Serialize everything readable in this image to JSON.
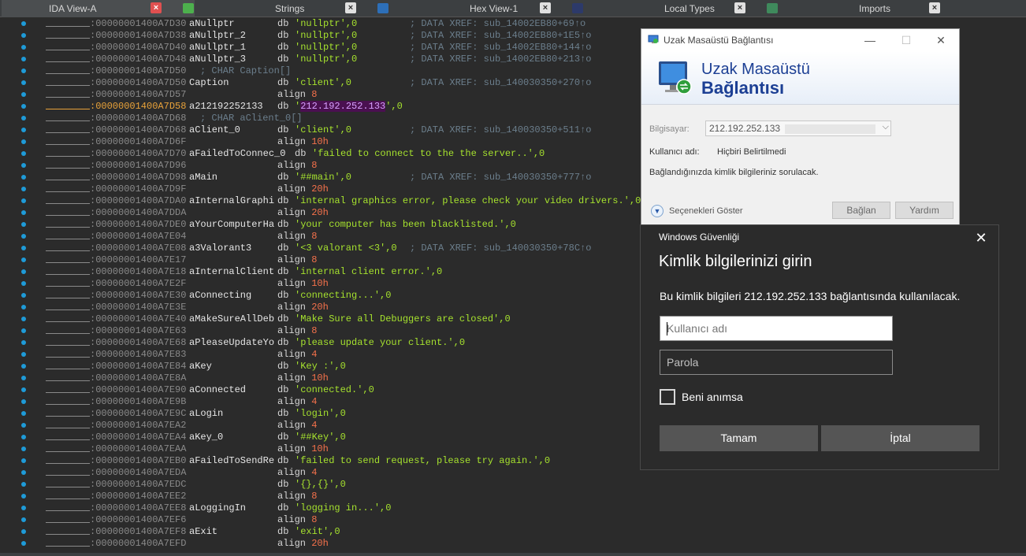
{
  "tabs": [
    {
      "label": "IDA View-A",
      "icon": "ida-view-icon",
      "active": true
    },
    {
      "label": "Strings",
      "icon": "strings-icon",
      "active": false
    },
    {
      "label": "Hex View-1",
      "icon": "hex-view-icon",
      "active": false
    },
    {
      "label": "Local Types",
      "icon": "local-types-icon",
      "active": false
    },
    {
      "label": "Imports",
      "icon": "imports-icon",
      "active": false
    }
  ],
  "listing": [
    {
      "addr": ":00000001400A7D30",
      "label": "aNullptr",
      "kw": "db",
      "op": "'nullptr',0",
      "cmt": "; DATA XREF: sub_14002EB80+69↑o"
    },
    {
      "addr": ":00000001400A7D38",
      "label": "aNullptr_2",
      "kw": "db",
      "op": "'nullptr',0",
      "cmt": "; DATA XREF: sub_14002EB80+1E5↑o"
    },
    {
      "addr": ":00000001400A7D40",
      "label": "aNullptr_1",
      "kw": "db",
      "op": "'nullptr',0",
      "cmt": "; DATA XREF: sub_14002EB80+144↑o"
    },
    {
      "addr": ":00000001400A7D48",
      "label": "aNullptr_3",
      "kw": "db",
      "op": "'nullptr',0",
      "cmt": "; DATA XREF: sub_14002EB80+213↑o"
    },
    {
      "addr": ":00000001400A7D50",
      "fullcmt": "; CHAR Caption[]"
    },
    {
      "addr": ":00000001400A7D50",
      "label": "Caption",
      "kw": "db",
      "op": "'client',0",
      "cmt": "; DATA XREF: sub_140030350+270↑o"
    },
    {
      "addr": ":00000001400A7D57",
      "align": "align",
      "alignNum": "8"
    },
    {
      "addr": ":00000001400A7D58",
      "label": "a212192252133",
      "kw": "db",
      "op": "'212.192.252.133',0",
      "highlight": true
    },
    {
      "addr": ":00000001400A7D68",
      "fullcmt": "; CHAR aClient_0[]"
    },
    {
      "addr": ":00000001400A7D68",
      "label": "aClient_0",
      "kw": "db",
      "op": "'client',0",
      "cmt": "; DATA XREF: sub_140030350+511↑o"
    },
    {
      "addr": ":00000001400A7D6F",
      "align": "align",
      "alignNum": "10h"
    },
    {
      "addr": ":00000001400A7D70",
      "label": "aFailedToConnec_0",
      "kw": "db",
      "op": "'failed to connect to the the server..',0",
      "wide": true
    },
    {
      "addr": ":00000001400A7D96",
      "align": "align",
      "alignNum": "8"
    },
    {
      "addr": ":00000001400A7D98",
      "label": "aMain",
      "kw": "db",
      "op": "'##main',0",
      "cmt": "; DATA XREF: sub_140030350+777↑o"
    },
    {
      "addr": ":00000001400A7D9F",
      "align": "align",
      "alignNum": "20h"
    },
    {
      "addr": ":00000001400A7DA0",
      "label": "aInternalGraphi",
      "kw": "db",
      "op": "'internal graphics error, please check your video drivers.',0"
    },
    {
      "addr": ":00000001400A7DDA",
      "align": "align",
      "alignNum": "20h"
    },
    {
      "addr": ":00000001400A7DE0",
      "label": "aYourComputerHa",
      "kw": "db",
      "op": "'your computer has been blacklisted.',0"
    },
    {
      "addr": ":00000001400A7E04",
      "align": "align",
      "alignNum": "8"
    },
    {
      "addr": ":00000001400A7E08",
      "label": "a3Valorant3",
      "kw": "db",
      "op": "'<3 valorant <3',0",
      "cmt": "; DATA XREF: sub_140030350+78C↑o"
    },
    {
      "addr": ":00000001400A7E17",
      "align": "align",
      "alignNum": "8"
    },
    {
      "addr": ":00000001400A7E18",
      "label": "aInternalClient",
      "kw": "db",
      "op": "'internal client error.',0"
    },
    {
      "addr": ":00000001400A7E2F",
      "align": "align",
      "alignNum": "10h"
    },
    {
      "addr": ":00000001400A7E30",
      "label": "aConnecting",
      "kw": "db",
      "op": "'connecting...',0"
    },
    {
      "addr": ":00000001400A7E3E",
      "align": "align",
      "alignNum": "20h"
    },
    {
      "addr": ":00000001400A7E40",
      "label": "aMakeSureAllDeb",
      "kw": "db",
      "op": "'Make Sure all Debuggers are closed',0"
    },
    {
      "addr": ":00000001400A7E63",
      "align": "align",
      "alignNum": "8"
    },
    {
      "addr": ":00000001400A7E68",
      "label": "aPleaseUpdateYo",
      "kw": "db",
      "op": "'please update your client.',0"
    },
    {
      "addr": ":00000001400A7E83",
      "align": "align",
      "alignNum": "4"
    },
    {
      "addr": ":00000001400A7E84",
      "label": "aKey",
      "kw": "db",
      "op": "'Key :',0"
    },
    {
      "addr": ":00000001400A7E8A",
      "align": "align",
      "alignNum": "10h"
    },
    {
      "addr": ":00000001400A7E90",
      "label": "aConnected",
      "kw": "db",
      "op": "'connected.',0"
    },
    {
      "addr": ":00000001400A7E9B",
      "align": "align",
      "alignNum": "4"
    },
    {
      "addr": ":00000001400A7E9C",
      "label": "aLogin",
      "kw": "db",
      "op": "'login',0"
    },
    {
      "addr": ":00000001400A7EA2",
      "align": "align",
      "alignNum": "4"
    },
    {
      "addr": ":00000001400A7EA4",
      "label": "aKey_0",
      "kw": "db",
      "op": "'##Key',0"
    },
    {
      "addr": ":00000001400A7EAA",
      "align": "align",
      "alignNum": "10h"
    },
    {
      "addr": ":00000001400A7EB0",
      "label": "aFailedToSendRe",
      "kw": "db",
      "op": "'failed to send request, please try again.',0"
    },
    {
      "addr": ":00000001400A7EDA",
      "align": "align",
      "alignNum": "4"
    },
    {
      "addr": ":00000001400A7EDC",
      "label": "",
      "kw": "db",
      "op": "'{},{}',0"
    },
    {
      "addr": ":00000001400A7EE2",
      "align": "align",
      "alignNum": "8"
    },
    {
      "addr": ":00000001400A7EE8",
      "label": "aLoggingIn",
      "kw": "db",
      "op": "'logging in...',0"
    },
    {
      "addr": ":00000001400A7EF6",
      "align": "align",
      "alignNum": "8"
    },
    {
      "addr": ":00000001400A7EF8",
      "label": "aExit",
      "kw": "db",
      "op": "'exit',0"
    },
    {
      "addr": ":00000001400A7EFD",
      "align": "align",
      "alignNum": "20h"
    }
  ],
  "rdp": {
    "title": "Uzak Masaüstü Bağlantısı",
    "banner_line1": "Uzak Masaüstü",
    "banner_line2": "Bağlantısı",
    "computer_label": "Bilgisayar:",
    "computer_value": "212.192.252.133",
    "user_label": "Kullanıcı adı:",
    "user_value": "Hiçbiri Belirtilmedi",
    "notice": "Bağlandığınızda kimlik bilgileriniz sorulacak.",
    "options_label": "Seçenekleri Göster",
    "connect_label": "Bağlan",
    "help_label": "Yardım"
  },
  "security": {
    "app_title": "Windows Güvenliği",
    "heading": "Kimlik bilgilerinizi girin",
    "description": "Bu kimlik bilgileri 212.192.252.133 bağlantısında kullanılacak.",
    "username_placeholder": "Kullanıcı adı",
    "password_placeholder": "Parola",
    "remember_label": "Beni anımsa",
    "ok_label": "Tamam",
    "cancel_label": "İptal"
  }
}
